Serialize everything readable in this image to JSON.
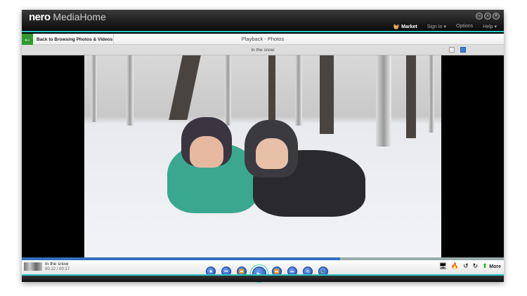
{
  "app": {
    "logo_brand": "nero",
    "logo_product": "MediaHome"
  },
  "window_buttons": [
    "minimize",
    "restore",
    "close"
  ],
  "menu": {
    "market": "Market",
    "sign_in": "Sign In ▾",
    "options": "Options",
    "help": "Help ▾"
  },
  "nav": {
    "back_label": "Back to Browsing Photos & Videos",
    "title": "Playback - Photos"
  },
  "subbar": {
    "title": "In the snow"
  },
  "player": {
    "item_title": "In the snow",
    "time": "00:12 / 00:17",
    "progress": 0.66,
    "buttons": [
      {
        "name": "stop",
        "glyph": "■"
      },
      {
        "name": "previous",
        "glyph": "⏮"
      },
      {
        "name": "rewind",
        "glyph": "⏪"
      },
      {
        "name": "play",
        "glyph": "▶"
      },
      {
        "name": "fast-forward",
        "glyph": "⏩"
      },
      {
        "name": "next",
        "glyph": "⏭"
      },
      {
        "name": "repeat",
        "glyph": "⟲"
      },
      {
        "name": "volume",
        "glyph": "🔈"
      }
    ],
    "more_label": "More"
  },
  "colors": {
    "accent": "#2cc6c0",
    "button_blue": "#1d4fb0",
    "back_green": "#2e9a2e"
  }
}
